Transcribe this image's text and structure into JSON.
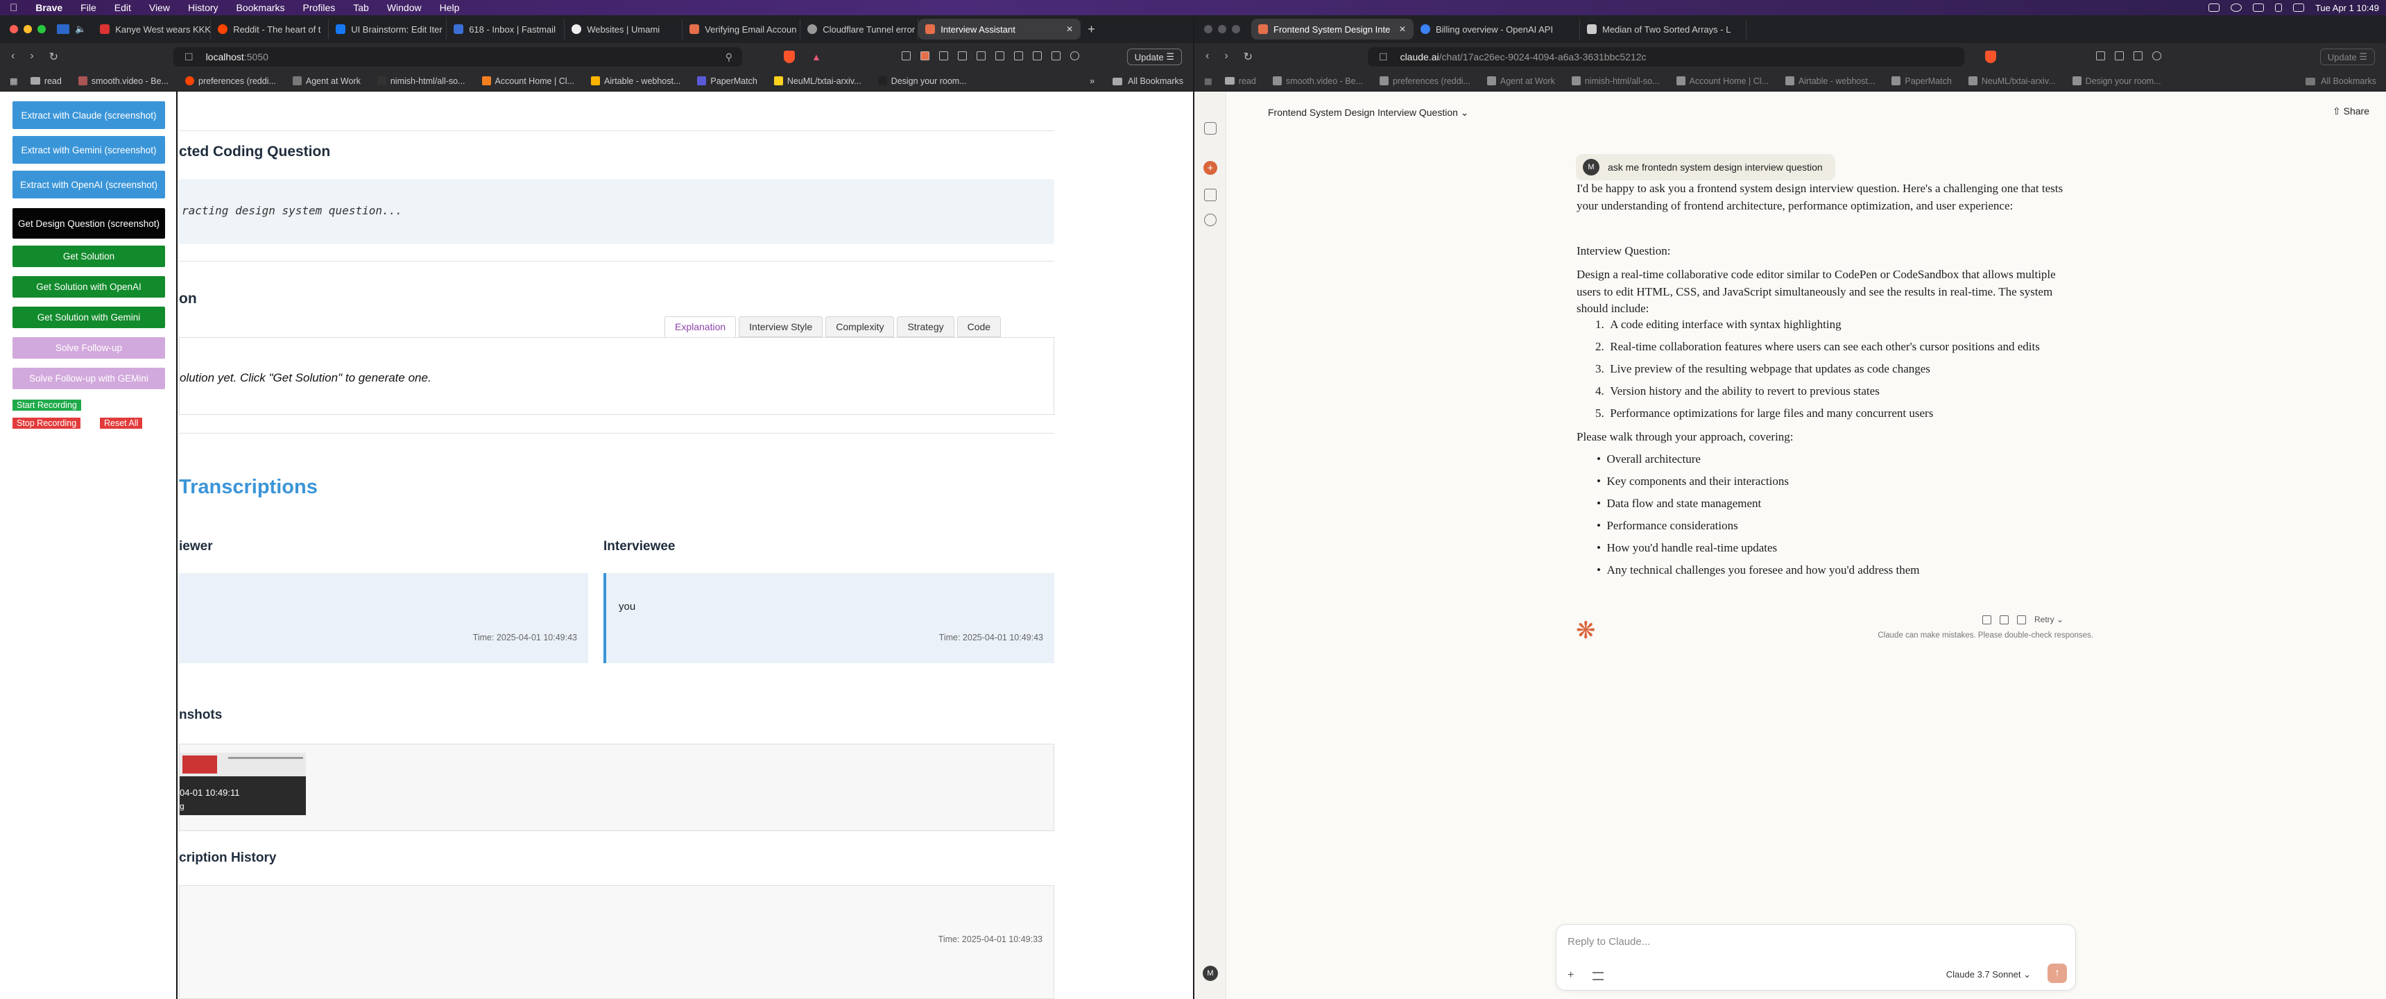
{
  "menubar": {
    "app": "Brave",
    "items": [
      "File",
      "Edit",
      "View",
      "History",
      "Bookmarks",
      "Profiles",
      "Tab",
      "Window",
      "Help"
    ],
    "datetime": "Tue Apr 1  10:49"
  },
  "left_window": {
    "tabs": [
      {
        "title": "Kanye West wears KKK",
        "color": "#d33"
      },
      {
        "title": "Reddit - The heart of t",
        "color": "#ff4500"
      },
      {
        "title": "UI Brainstorm: Edit Iter",
        "color": "#1877f2"
      },
      {
        "title": "618 - Inbox | Fastmail",
        "color": "#3b6fd4"
      },
      {
        "title": "Websites | Umami",
        "color": "#111"
      },
      {
        "title": "Verifying Email Accoun",
        "color": "#e56f4a"
      },
      {
        "title": "Cloudflare Tunnel error",
        "color": "#888"
      },
      {
        "title": "Interview Assistant",
        "color": "#e56f4a",
        "active": true
      }
    ],
    "url": {
      "host": "localhost",
      "port": ":5050"
    },
    "update_label": "Update",
    "bookmarks": [
      "read",
      "smooth.video - Be...",
      "preferences (reddi...",
      "Agent at Work",
      "nimish-html/all-so...",
      "Account Home | Cl...",
      "Airtable - webhost...",
      "PaperMatch",
      "NeuML/txtai-arxiv...",
      "Design your room..."
    ],
    "all_bookmarks": "All Bookmarks"
  },
  "control_panel": {
    "buttons": [
      {
        "label": "Extract with Claude (screenshot)",
        "style": "blue"
      },
      {
        "label": "Extract with Gemini (screenshot)",
        "style": "blue"
      },
      {
        "label": "Extract with OpenAI (screenshot)",
        "style": "blue"
      },
      {
        "label": "Get Design Question (screenshot)",
        "style": "black"
      },
      {
        "label": "Get Solution",
        "style": "green"
      },
      {
        "label": "Get Solution with OpenAI",
        "style": "green"
      },
      {
        "label": "Get Solution with Gemini",
        "style": "green"
      },
      {
        "label": "Solve Follow-up",
        "style": "lavender"
      },
      {
        "label": "Solve Follow-up with GEMini",
        "style": "lavender"
      }
    ],
    "start_recording": "Start Recording",
    "stop_recording": "Stop Recording",
    "reset_all": "Reset All"
  },
  "main": {
    "question_heading": "cted Coding Question",
    "question_text": "racting design system question...",
    "solution_heading": "on",
    "solution_tabs": [
      "Explanation",
      "Interview Style",
      "Complexity",
      "Strategy",
      "Code"
    ],
    "solution_placeholder": "olution yet. Click \"Get Solution\" to generate one.",
    "transcriptions_heading": "Transcriptions",
    "interviewer_heading": "iewer",
    "interviewee_heading": "Interviewee",
    "interviewer_time": "Time: 2025-04-01 10:49:43",
    "interviewee_text": "you",
    "interviewee_time": "Time: 2025-04-01 10:49:43",
    "screenshots_heading": "nshots",
    "screenshot_caption": "04-01 10:49:11",
    "screenshot_sub": "g",
    "history_heading": "cription History",
    "history_time": "Time: 2025-04-01 10:49:33"
  },
  "right_window": {
    "tabs": [
      {
        "title": "Frontend System Design Inte",
        "color": "#e56f4a",
        "active": true
      },
      {
        "title": "Billing overview - OpenAI API",
        "color": "#3b82f6"
      },
      {
        "title": "Median of Two Sorted Arrays - L",
        "color": "#777"
      }
    ],
    "url": {
      "host": "claude.ai",
      "path": "/chat/17ac26ec-9024-4094-a6a3-3631bbc5212c"
    },
    "update_label": "Update",
    "bookmarks": [
      "read",
      "smooth.video - Be...",
      "preferences (reddi...",
      "Agent at Work",
      "nimish-html/all-so...",
      "Account Home | Cl...",
      "Airtable - webhost...",
      "PaperMatch",
      "NeuML/txtai-arxiv...",
      "Design your room..."
    ],
    "all_bookmarks": "All Bookmarks"
  },
  "claude": {
    "conversation_title": "Frontend System Design Interview Question",
    "share_label": "Share",
    "user_initial": "M",
    "user_message": "ask me frontedn system design interview question",
    "intro": "I'd be happy to ask you a frontend system design interview question. Here's a challenging one that tests your understanding of frontend architecture, performance optimization, and user experience:",
    "question_label": "Interview Question:",
    "question_body": "Design a real-time collaborative code editor similar to CodePen or CodeSandbox that allows multiple users to edit HTML, CSS, and JavaScript simultaneously and see the results in real-time. The system should include:",
    "requirements": [
      "A code editing interface with syntax highlighting",
      "Real-time collaboration features where users can see each other's cursor positions and edits",
      "Live preview of the resulting webpage that updates as code changes",
      "Version history and the ability to revert to previous states",
      "Performance optimizations for large files and many concurrent users"
    ],
    "walkthrough_intro": "Please walk through your approach, covering:",
    "walkthrough": [
      "Overall architecture",
      "Key components and their interactions",
      "Data flow and state management",
      "Performance considerations",
      "How you'd handle real-time updates",
      "Any technical challenges you foresee and how you'd address them"
    ],
    "retry_label": "Retry",
    "disclaimer": "Claude can make mistakes. Please double-check responses.",
    "reply_placeholder": "Reply to Claude...",
    "model": "Claude 3.7 Sonnet",
    "footer_initial": "M"
  }
}
